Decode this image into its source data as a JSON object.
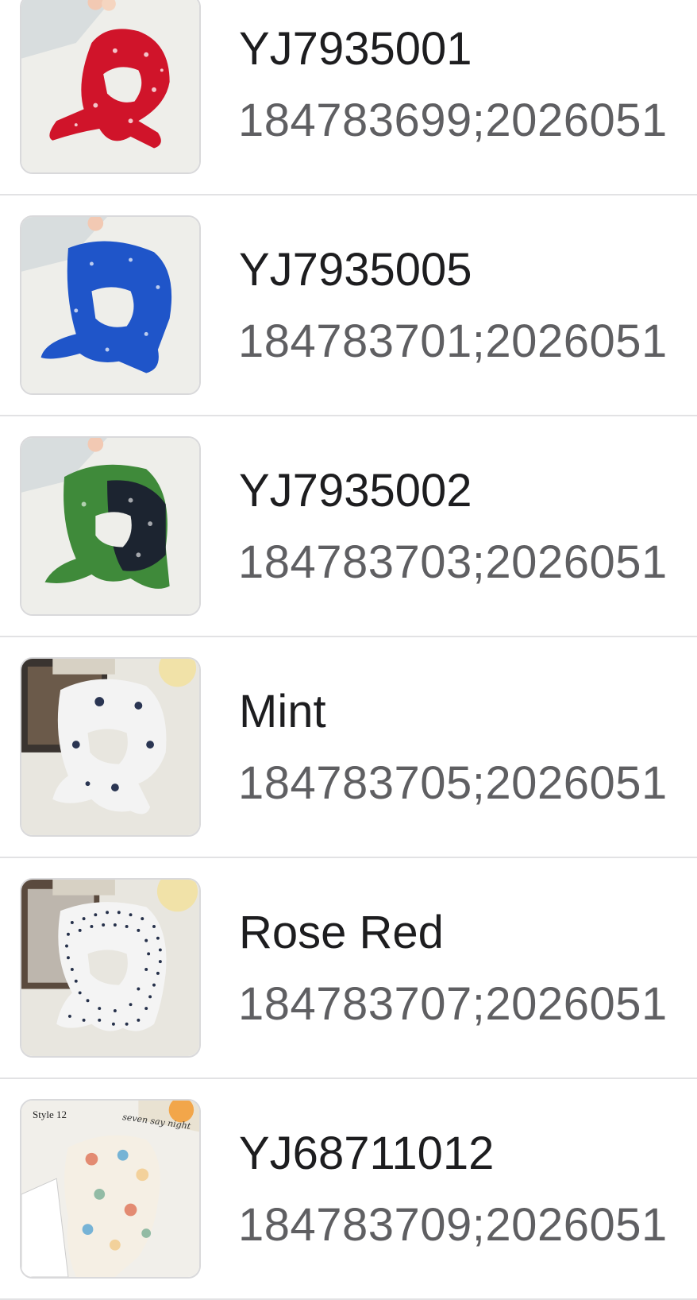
{
  "items": [
    {
      "title": "YJ7935001",
      "sku_line": "184783699;2026051",
      "thumb": {
        "icon": "red-paisley-scarf-image",
        "scarf_color": "#d0142a",
        "accent": "#ffffff",
        "backdrop": "#eeeeea"
      }
    },
    {
      "title": "YJ7935005",
      "sku_line": "184783701;2026051",
      "thumb": {
        "icon": "blue-paisley-scarf-image",
        "scarf_color": "#1f55c9",
        "accent": "#ffffff",
        "backdrop": "#eeeeea"
      }
    },
    {
      "title": "YJ7935002",
      "sku_line": "184783703;2026051",
      "thumb": {
        "icon": "green-paisley-scarf-image",
        "scarf_color": "#3f8a3a",
        "accent": "#1c2430",
        "backdrop": "#eeeeea"
      }
    },
    {
      "title": "Mint",
      "sku_line": "184783705;2026051",
      "thumb": {
        "icon": "white-paisley-scarf-image",
        "scarf_color": "#f3f3f3",
        "accent": "#2a3552",
        "backdrop": "#e8e6df"
      }
    },
    {
      "title": "Rose Red",
      "sku_line": "184783707;2026051",
      "thumb": {
        "icon": "polka-dot-scarf-image",
        "scarf_color": "#f4f4f4",
        "accent": "#25304a",
        "backdrop": "#e8e6df"
      }
    },
    {
      "title": "YJ68711012",
      "sku_line": "184783709;2026051",
      "thumb": {
        "icon": "floral-pastel-scarf-image",
        "scarf_color": "#f5efe4",
        "accent": "#e07a5f",
        "backdrop": "#f1efea",
        "style_label": "Style 12",
        "handwriting": "seven say night"
      }
    }
  ]
}
